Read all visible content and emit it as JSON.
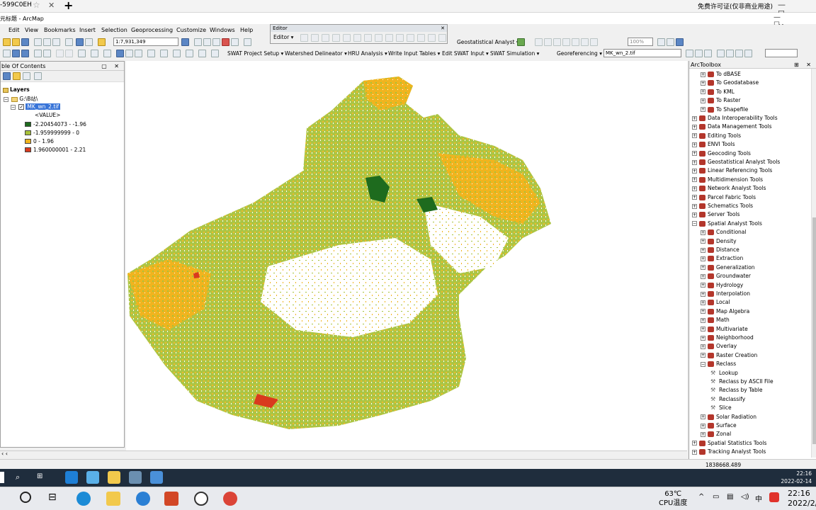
{
  "remote_strip": {
    "tab_text": "-599C0EH",
    "close_glyph": "✕",
    "plus_glyph": "+",
    "license_text": "免费许可证(仅非商业用途)",
    "win_buttons": "— ☐ ✕"
  },
  "window": {
    "title": "元标题 - ArcMap",
    "win_buttons": "— ☐ ✕"
  },
  "menu": [
    "Edit",
    "View",
    "Bookmarks",
    "Insert",
    "Selection",
    "Geoprocessing",
    "Customize",
    "Windows",
    "Help"
  ],
  "toolbar": {
    "scale_value": "1:7,931,349",
    "geostat_label": "Geostatistical Analyst ▾",
    "zoom_combo": "100%",
    "swat_items": [
      "SWAT Project Setup ▾",
      "Watershed Delineator ▾",
      "HRU Analysis ▾",
      "Write Input Tables ▾",
      "Edit SWAT Input ▾",
      "SWAT Simulation ▾"
    ],
    "georef_label": "Georeferencing ▾",
    "georef_layer": "MK_wn_2.tif"
  },
  "editor": {
    "caption": "Editor",
    "close_glyph": "✕",
    "menu_label": "Editor ▾"
  },
  "toc": {
    "caption": "ble Of Contents",
    "caption_ctrl": "▢ ✕",
    "layers_label": "Layers",
    "folder_label": "G:\\B站\\",
    "layer_name": "MK_wn_2.tif",
    "value_label": "<VALUE>",
    "classes": [
      {
        "label": "-2.20454073 - -1.96",
        "color": "#1e6b1e"
      },
      {
        "label": "-1.959999999 - 0",
        "color": "#a8c23a"
      },
      {
        "label": "0 - 1.96",
        "color": "#f0b41e"
      },
      {
        "label": "1.960000001 - 2.21",
        "color": "#d93a1e"
      }
    ]
  },
  "toolbox": {
    "caption": "ArcToolbox",
    "caption_ctrl": "⊞ ✕",
    "items": [
      {
        "label": "To dBASE",
        "level": 1,
        "pm": "+",
        "icon": "toolset-icon"
      },
      {
        "label": "To Geodatabase",
        "level": 1,
        "pm": "+",
        "icon": "toolset-icon"
      },
      {
        "label": "To KML",
        "level": 1,
        "pm": "+",
        "icon": "toolset-icon"
      },
      {
        "label": "To Raster",
        "level": 1,
        "pm": "+",
        "icon": "toolset-icon"
      },
      {
        "label": "To Shapefile",
        "level": 1,
        "pm": "+",
        "icon": "toolset-icon"
      },
      {
        "label": "Data Interoperability Tools",
        "level": 0,
        "pm": "+",
        "icon": "toolbox-icon"
      },
      {
        "label": "Data Management Tools",
        "level": 0,
        "pm": "+",
        "icon": "toolbox-icon"
      },
      {
        "label": "Editing Tools",
        "level": 0,
        "pm": "+",
        "icon": "toolbox-icon"
      },
      {
        "label": "ENVI Tools",
        "level": 0,
        "pm": "+",
        "icon": "toolbox-icon"
      },
      {
        "label": "Geocoding Tools",
        "level": 0,
        "pm": "+",
        "icon": "toolbox-icon"
      },
      {
        "label": "Geostatistical Analyst Tools",
        "level": 0,
        "pm": "+",
        "icon": "toolbox-icon"
      },
      {
        "label": "Linear Referencing Tools",
        "level": 0,
        "pm": "+",
        "icon": "toolbox-icon"
      },
      {
        "label": "Multidimension Tools",
        "level": 0,
        "pm": "+",
        "icon": "toolbox-icon"
      },
      {
        "label": "Network Analyst Tools",
        "level": 0,
        "pm": "+",
        "icon": "toolbox-icon"
      },
      {
        "label": "Parcel Fabric Tools",
        "level": 0,
        "pm": "+",
        "icon": "toolbox-icon"
      },
      {
        "label": "Schematics Tools",
        "level": 0,
        "pm": "+",
        "icon": "toolbox-icon"
      },
      {
        "label": "Server Tools",
        "level": 0,
        "pm": "+",
        "icon": "toolbox-icon"
      },
      {
        "label": "Spatial Analyst Tools",
        "level": 0,
        "pm": "−",
        "icon": "toolbox-icon"
      },
      {
        "label": "Conditional",
        "level": 1,
        "pm": "+",
        "icon": "toolset-icon"
      },
      {
        "label": "Density",
        "level": 1,
        "pm": "+",
        "icon": "toolset-icon"
      },
      {
        "label": "Distance",
        "level": 1,
        "pm": "+",
        "icon": "toolset-icon"
      },
      {
        "label": "Extraction",
        "level": 1,
        "pm": "+",
        "icon": "toolset-icon"
      },
      {
        "label": "Generalization",
        "level": 1,
        "pm": "+",
        "icon": "toolset-icon"
      },
      {
        "label": "Groundwater",
        "level": 1,
        "pm": "+",
        "icon": "toolset-icon"
      },
      {
        "label": "Hydrology",
        "level": 1,
        "pm": "+",
        "icon": "toolset-icon"
      },
      {
        "label": "Interpolation",
        "level": 1,
        "pm": "+",
        "icon": "toolset-icon"
      },
      {
        "label": "Local",
        "level": 1,
        "pm": "+",
        "icon": "toolset-icon"
      },
      {
        "label": "Map Algebra",
        "level": 1,
        "pm": "+",
        "icon": "toolset-icon"
      },
      {
        "label": "Math",
        "level": 1,
        "pm": "+",
        "icon": "toolset-icon"
      },
      {
        "label": "Multivariate",
        "level": 1,
        "pm": "+",
        "icon": "toolset-icon"
      },
      {
        "label": "Neighborhood",
        "level": 1,
        "pm": "+",
        "icon": "toolset-icon"
      },
      {
        "label": "Overlay",
        "level": 1,
        "pm": "+",
        "icon": "toolset-icon"
      },
      {
        "label": "Raster Creation",
        "level": 1,
        "pm": "+",
        "icon": "toolset-icon"
      },
      {
        "label": "Reclass",
        "level": 1,
        "pm": "−",
        "icon": "toolset-icon"
      },
      {
        "label": "Lookup",
        "level": 2,
        "pm": "",
        "icon": "hammer-icon"
      },
      {
        "label": "Reclass by ASCII File",
        "level": 2,
        "pm": "",
        "icon": "hammer-icon"
      },
      {
        "label": "Reclass by Table",
        "level": 2,
        "pm": "",
        "icon": "hammer-icon"
      },
      {
        "label": "Reclassify",
        "level": 2,
        "pm": "",
        "icon": "hammer-icon"
      },
      {
        "label": "Slice",
        "level": 2,
        "pm": "",
        "icon": "hammer-icon"
      },
      {
        "label": "Solar Radiation",
        "level": 1,
        "pm": "+",
        "icon": "toolset-icon"
      },
      {
        "label": "Surface",
        "level": 1,
        "pm": "+",
        "icon": "toolset-icon"
      },
      {
        "label": "Zonal",
        "level": 1,
        "pm": "+",
        "icon": "toolset-icon"
      },
      {
        "label": "Spatial Statistics Tools",
        "level": 0,
        "pm": "+",
        "icon": "toolbox-icon"
      },
      {
        "label": "Tracking Analyst Tools",
        "level": 0,
        "pm": "+",
        "icon": "toolbox-icon"
      }
    ]
  },
  "status": {
    "coordinates": "1838668.489"
  },
  "remote_taskbar": {
    "time": "22:16",
    "date": "2022-02-14"
  },
  "taskbar": {
    "temp": "63℃",
    "temp_label": "CPU温度",
    "ime": "中",
    "time": "22:16",
    "date": "2022/2/"
  },
  "colors": {
    "dark_green": "#1e6b1e",
    "yellow_green": "#a8c23a",
    "orange": "#f0b41e",
    "red": "#d93a1e"
  }
}
